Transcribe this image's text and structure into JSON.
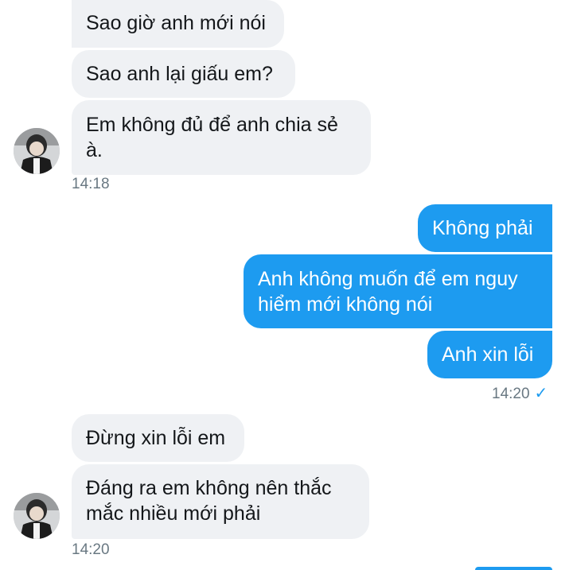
{
  "thread": {
    "group1": {
      "messages": [
        {
          "text": "Sao giờ anh mới nói"
        },
        {
          "text": "Sao anh lại giấu em?"
        },
        {
          "text": "Em không đủ để anh chia sẻ à."
        }
      ],
      "time": "14:18"
    },
    "group2": {
      "messages": [
        {
          "text": "Không phải"
        },
        {
          "text": "Anh không muốn để em nguy hiểm mới không nói"
        },
        {
          "text": "Anh xin lỗi"
        }
      ],
      "time": "14:20",
      "status_icon": "check-icon"
    },
    "group3": {
      "messages": [
        {
          "text": "Đừng xin lỗi em"
        },
        {
          "text": "Đáng ra em không nên thắc mắc nhiều mới phải"
        }
      ],
      "time": "14:20"
    }
  },
  "colors": {
    "incoming_bubble": "#eff1f4",
    "outgoing_bubble": "#1d9bf0",
    "timestamp": "#697882"
  }
}
